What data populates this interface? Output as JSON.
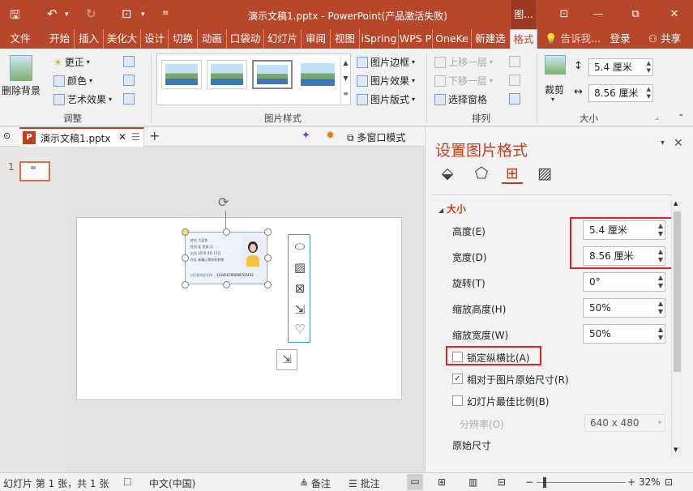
{
  "titlebar": {
    "save_icon": "save-icon",
    "doc_title": "演示文稿1.pptx - PowerPoint(产品激活失败)",
    "context_tab": "图...",
    "minimize": "—",
    "restore": "⧉",
    "close": "✕"
  },
  "tabs": [
    "文件",
    "开始",
    "插入",
    "美化大",
    "设计",
    "切换",
    "动画",
    "口袋动",
    "幻灯片",
    "审阅",
    "视图",
    "iSpring",
    "WPS P",
    "OneKe",
    "新建选",
    "格式"
  ],
  "tell_me": "告诉我...",
  "login": "登录",
  "share": "共享",
  "ribbon": {
    "remove_bg": "删除背景",
    "corrections": "更正",
    "color": "颜色",
    "artistic": "艺术效果",
    "adjust_label": "调整",
    "picture_border": "图片边框",
    "picture_effects": "图片效果",
    "picture_layout": "图片版式",
    "styles_label": "图片样式",
    "bring_forward": "上移一层",
    "send_backward": "下移一层",
    "selection_pane": "选择窗格",
    "arrange_label": "排列",
    "crop": "裁剪",
    "height": "5.4 厘米",
    "width": "8.56 厘米",
    "size_label": "大小"
  },
  "doctab": {
    "name": "演示文稿1.pptx",
    "multi_window": "多窗口模式"
  },
  "slide_panel": {
    "number": "1"
  },
  "card": {
    "lines": [
      "姓名 大蓝鱼",
      "性别 女  民族 汉",
      "出生 2016  9月 11日",
      "住址 新疆心荣你的梦想"
    ],
    "id_label": "公民身份证号码",
    "id_number": "123456789098765432"
  },
  "pane": {
    "title": "设置图片格式",
    "section": "大小",
    "height_label": "高度(E)",
    "height_value": "5.4 厘米",
    "width_label": "宽度(D)",
    "width_value": "8.56 厘米",
    "rotation_label": "旋转(T)",
    "rotation_value": "0°",
    "scale_h_label": "缩放高度(H)",
    "scale_h_value": "50%",
    "scale_w_label": "缩放宽度(W)",
    "scale_w_value": "50%",
    "lock_aspect": "锁定纵横比(A)",
    "lock_aspect_checked": false,
    "relative_original": "相对于图片原始尺寸(R)",
    "relative_original_checked": true,
    "best_scale": "幻灯片最佳比例(B)",
    "best_scale_checked": false,
    "resolution_label": "分辨率(O)",
    "resolution_value": "640 x 480",
    "original_size": "原始尺寸"
  },
  "statusbar": {
    "slide_info": "幻灯片 第 1 张，共 1 张",
    "language": "中文(中国)",
    "notes": "备注",
    "comments": "批注",
    "zoom": "32%"
  },
  "colors": {
    "accent": "#b7472a",
    "highlight": "#e0231c"
  }
}
